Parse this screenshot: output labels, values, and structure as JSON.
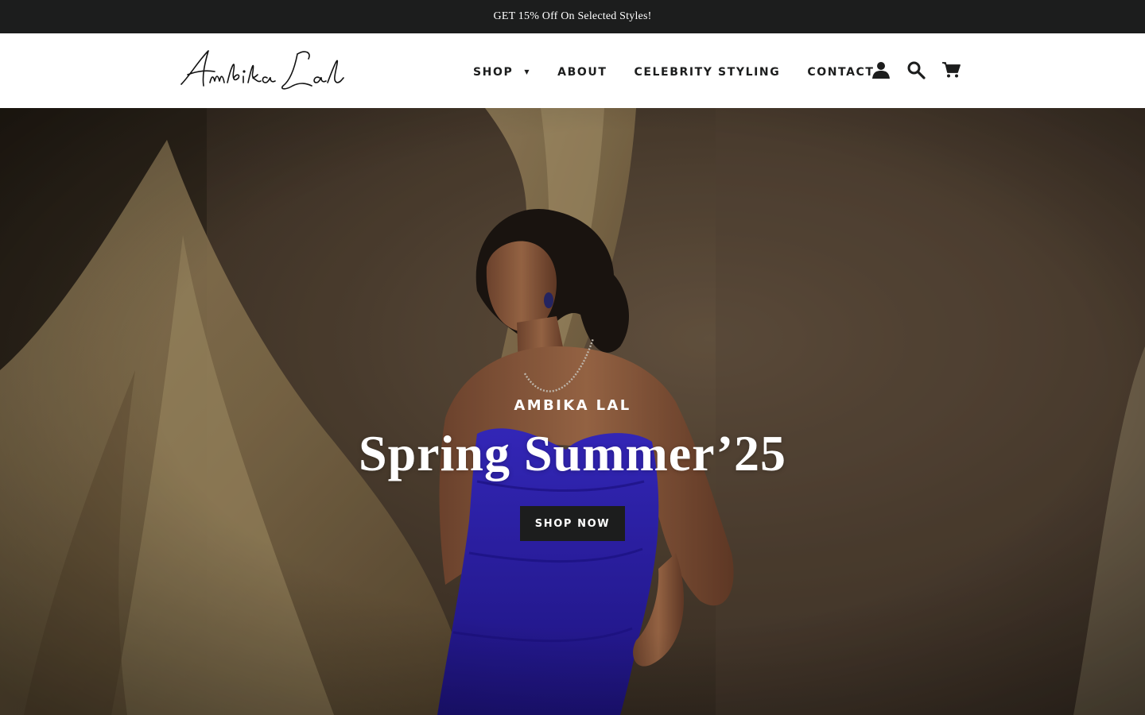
{
  "announcement": {
    "text": "GET 15% Off On Selected Styles!"
  },
  "header": {
    "logo_text": "Ambika Lal",
    "nav": [
      {
        "label": "Shop",
        "has_dropdown": true
      },
      {
        "label": "About"
      },
      {
        "label": "Celebrity Styling"
      },
      {
        "label": "Contact"
      }
    ],
    "icons": [
      "account-icon",
      "search-icon",
      "cart-icon"
    ]
  },
  "hero": {
    "subtitle": "Ambika Lal",
    "title": "Spring Summer’25",
    "cta_label": "Shop now"
  },
  "colors": {
    "announcement_bg": "#1c1d1d",
    "header_bg": "#ffffff",
    "text_dark": "#1c1d1d",
    "button_bg": "#1c1d1d",
    "dress_blue": "#2c1fb3"
  }
}
